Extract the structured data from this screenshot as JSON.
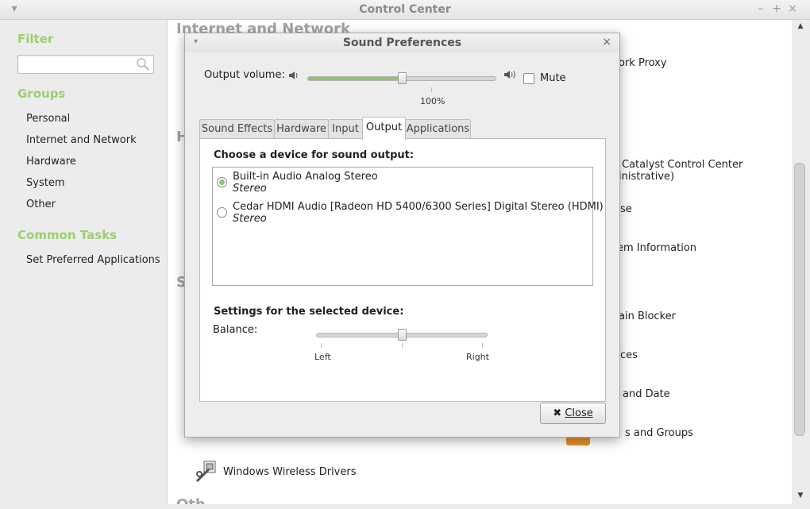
{
  "control_center": {
    "title": "Control Center",
    "sidebar": {
      "filter_heading": "Filter",
      "filter_value": "",
      "groups_heading": "Groups",
      "groups": [
        "Personal",
        "Internet and Network",
        "Hardware",
        "System",
        "Other"
      ],
      "common_tasks_heading": "Common Tasks",
      "tasks": [
        "Set Preferred Applications"
      ]
    },
    "main": {
      "section_internet": "Internet and Network",
      "section_h_partial": "H",
      "section_s_partial": "S",
      "section_other_partial": "Oth",
      "items": {
        "network_proxy": "ork Proxy",
        "catalyst_line1": "Catalyst Control Center",
        "catalyst_line2": "inistrative)",
        "mouse": "se",
        "system_info": "em Information",
        "domain_blocker": "ain Blocker",
        "services": "ces",
        "time_date": "and Date",
        "users_groups": "s and Groups",
        "wireless_drivers": "Windows Wireless Drivers"
      }
    }
  },
  "dialog": {
    "title": "Sound Preferences",
    "output_volume_label": "Output volume:",
    "volume_percent_label": "100%",
    "volume_level": 0.5,
    "mute_label": "Mute",
    "mute_checked": false,
    "tabs": [
      "Sound Effects",
      "Hardware",
      "Input",
      "Output",
      "Applications"
    ],
    "active_tab": "Output",
    "choose_device_label": "Choose a device for sound output:",
    "devices": [
      {
        "name": "Built-in Audio Analog Stereo",
        "profile": "Stereo",
        "selected": true
      },
      {
        "name": "Cedar HDMI Audio [Radeon HD 5400/6300 Series] Digital Stereo (HDMI)",
        "profile": "Stereo",
        "selected": false
      }
    ],
    "settings_label": "Settings for the selected device:",
    "balance_label": "Balance:",
    "balance_level": 0.5,
    "balance_left": "Left",
    "balance_right": "Right",
    "close_label": "Close"
  },
  "colors": {
    "accent_green": "#8cc56a",
    "sidebar_heading": "#9ccf6e",
    "section_heading": "#a3a3a3"
  }
}
